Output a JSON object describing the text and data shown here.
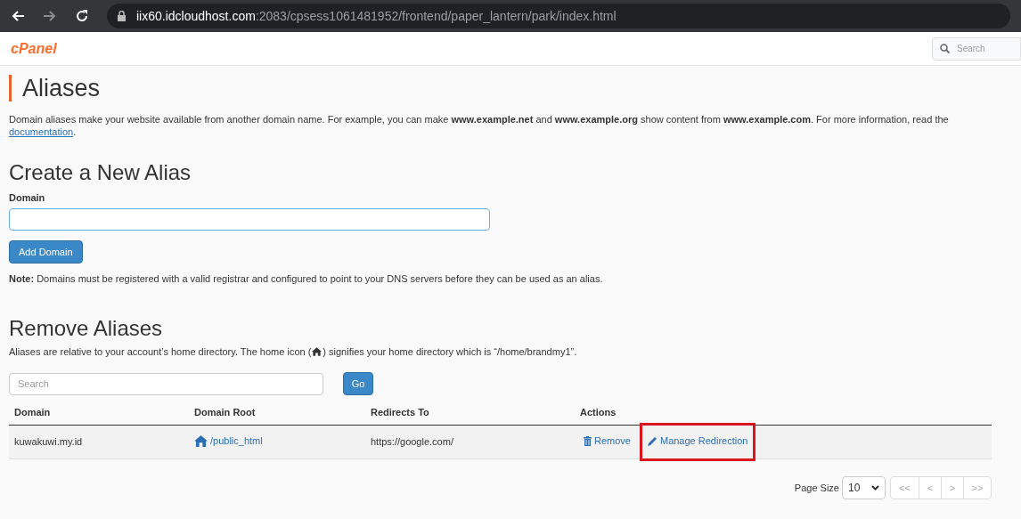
{
  "browser": {
    "url_host": "iix60.idcloudhost.com",
    "url_path": ":2083/cpsess1061481952/frontend/paper_lantern/park/index.html",
    "forward_disabled": true
  },
  "header": {
    "logo": "cPanel",
    "search_placeholder": "Search"
  },
  "page": {
    "title": "Aliases",
    "description": "Domain aliases make your website available from another domain name. For example, you can make **www.example.net** and **www.example.org** show content from **www.example.com**. For more information, read the",
    "doc_link": "documentation",
    "doc_after": "."
  },
  "create": {
    "heading": "Create a New Alias",
    "field_label": "Domain",
    "button": "Add Domain",
    "note": "**Note:** Domains must be registered with a valid registrar and configured to point to your DNS servers before they can be used as an alias."
  },
  "remove": {
    "heading": "Remove Aliases",
    "description_before": "Aliases are relative to your account’s home directory. The home icon (",
    "description_after": ") signifies your home directory which is “/home/brandmy1”.",
    "search_placeholder": "Search",
    "go_button": "Go"
  },
  "table": {
    "columns": [
      "Domain",
      "Domain Root",
      "Redirects To",
      "Actions"
    ],
    "rows": [
      {
        "domain": "kuwakuwi.my.id",
        "root": "/public_html",
        "redirect": "https://google.com/",
        "actions": [
          {
            "kind": "remove",
            "label": "Remove",
            "highlighted": false
          },
          {
            "kind": "redirect",
            "label": "Manage Redirection",
            "highlighted": true
          }
        ]
      }
    ]
  },
  "pagination": {
    "label": "Page Size",
    "page_size": "10",
    "buttons": [
      "<<",
      "<",
      ">",
      ">>"
    ]
  }
}
